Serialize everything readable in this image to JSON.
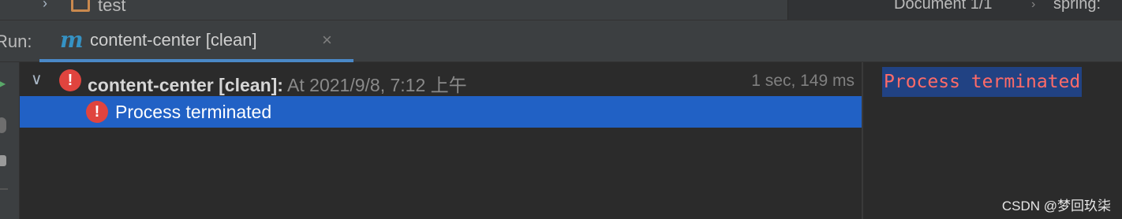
{
  "project_tree": {
    "chevron": "›",
    "folder_label": "test"
  },
  "breadcrumb": {
    "document": "Document 1/1",
    "separator": "›",
    "context": "spring:"
  },
  "run_panel": {
    "label": "Run:",
    "tab": {
      "icon": "m",
      "title": "content-center [clean]",
      "close": "×"
    }
  },
  "tree": {
    "rows": [
      {
        "expand": "∨",
        "status_icon": "!",
        "name": "content-center",
        "goal": " [clean]:",
        "started": " At 2021/9/8, 7:12 上午",
        "duration": "1 sec, 149 ms"
      },
      {
        "status_icon": "!",
        "text": "Process terminated"
      }
    ]
  },
  "console": {
    "line": "Process terminated"
  },
  "watermark": "CSDN @梦回玖柒",
  "colors": {
    "selection": "#2161c5",
    "error": "#e0443e",
    "console_text": "#ff6b68",
    "tab_underline": "#4a88c7"
  }
}
